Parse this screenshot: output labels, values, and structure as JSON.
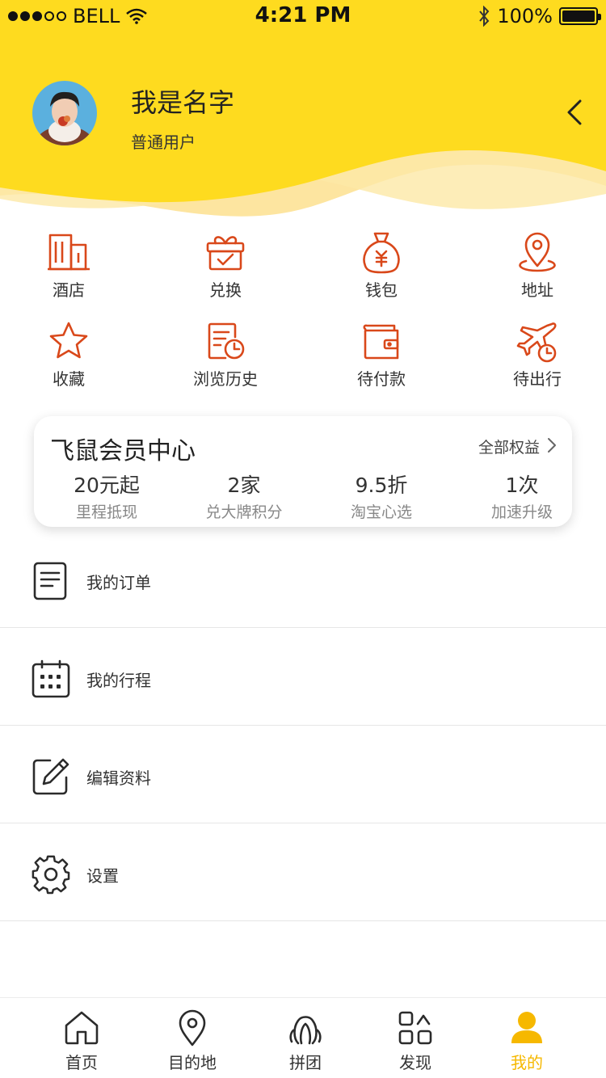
{
  "status_bar": {
    "carrier": "BELL",
    "time": "4:21 PM",
    "battery": "100%"
  },
  "profile": {
    "name": "我是名字",
    "level": "普通用户"
  },
  "colors": {
    "header_yellow": "#fedb1f",
    "icon_orange": "#d9481a",
    "active_tab": "#f6b800"
  },
  "quick_actions": [
    {
      "label": "酒店",
      "icon": "hotel-icon"
    },
    {
      "label": "兑换",
      "icon": "gift-icon"
    },
    {
      "label": "钱包",
      "icon": "money-bag-icon"
    },
    {
      "label": "地址",
      "icon": "location-pin-icon"
    },
    {
      "label": "收藏",
      "icon": "star-icon"
    },
    {
      "label": "浏览历史",
      "icon": "history-icon"
    },
    {
      "label": "待付款",
      "icon": "wallet-icon"
    },
    {
      "label": "待出行",
      "icon": "plane-clock-icon"
    }
  ],
  "member_center": {
    "title": "飞鼠会员中心",
    "all_benefits": "全部权益",
    "benefits": [
      {
        "value": "20元起",
        "desc": "里程抵现"
      },
      {
        "value": "2家",
        "desc": "兑大牌积分"
      },
      {
        "value": "9.5折",
        "desc": "淘宝心选"
      },
      {
        "value": "1次",
        "desc": "加速升级"
      }
    ]
  },
  "menu": [
    {
      "label": "我的订单",
      "icon": "document-icon"
    },
    {
      "label": "我的行程",
      "icon": "calendar-icon"
    },
    {
      "label": "编辑资料",
      "icon": "edit-icon"
    },
    {
      "label": "设置",
      "icon": "gear-icon"
    }
  ],
  "tabs": [
    {
      "label": "首页",
      "icon": "home-icon"
    },
    {
      "label": "目的地",
      "icon": "location-icon"
    },
    {
      "label": "拼团",
      "icon": "group-icon"
    },
    {
      "label": "发现",
      "icon": "discover-icon"
    },
    {
      "label": "我的",
      "icon": "user-icon",
      "active": true
    }
  ]
}
